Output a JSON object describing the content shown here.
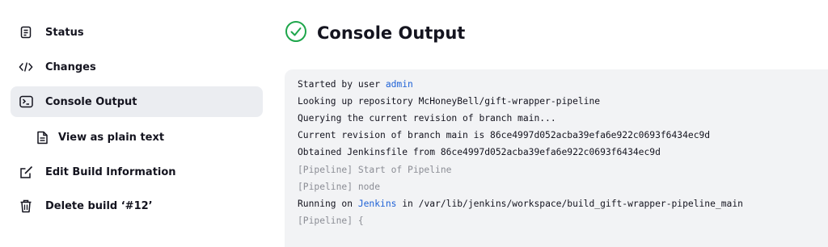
{
  "sidebar": {
    "items": [
      {
        "label": "Status",
        "icon": "status-icon"
      },
      {
        "label": "Changes",
        "icon": "code-icon"
      },
      {
        "label": "Console Output",
        "icon": "terminal-icon",
        "active": true
      },
      {
        "label": "View as plain text",
        "icon": "document-icon"
      },
      {
        "label": "Edit Build Information",
        "icon": "edit-icon"
      },
      {
        "label": "Delete build ‘#12’",
        "icon": "trash-icon"
      }
    ]
  },
  "header": {
    "title": "Console Output",
    "status_icon": "success-check-icon",
    "status_color": "#1ea64b"
  },
  "console": {
    "lines": [
      {
        "prefix": "Started by user ",
        "link": "admin",
        "suffix": ""
      },
      {
        "text": "Looking up repository McHoneyBell/gift-wrapper-pipeline"
      },
      {
        "text": "Querying the current revision of branch main..."
      },
      {
        "text": "Current revision of branch main is 86ce4997d052acba39efa6e922c0693f6434ec9d"
      },
      {
        "text": "Obtained Jenkinsfile from 86ce4997d052acba39efa6e922c0693f6434ec9d"
      },
      {
        "text": "[Pipeline] Start of Pipeline",
        "muted": true
      },
      {
        "text": "[Pipeline] node",
        "muted": true
      },
      {
        "prefix": "Running on ",
        "link": "Jenkins",
        "suffix": " in /var/lib/jenkins/workspace/build_gift-wrapper-pipeline_main"
      },
      {
        "text": "[Pipeline] {",
        "muted": true
      }
    ],
    "link_color": "#1f62d6",
    "muted_color": "#8b8d95"
  }
}
